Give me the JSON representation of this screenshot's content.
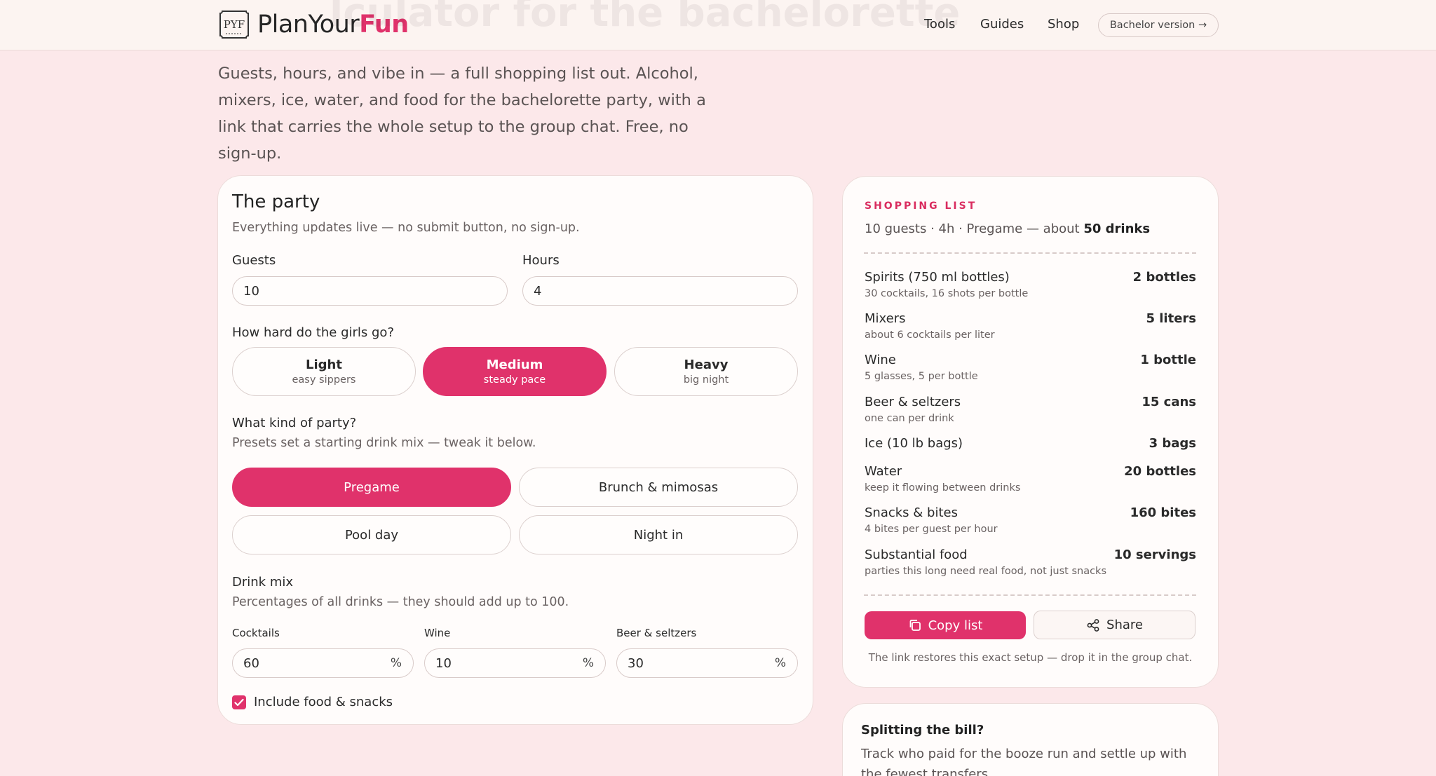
{
  "header": {
    "logo_mark_text": "PYF",
    "logo_plan": "PlanYour",
    "logo_fun": "Fun",
    "nav": [
      {
        "label": "Tools"
      },
      {
        "label": "Guides"
      },
      {
        "label": "Shop"
      }
    ],
    "bachelor_button": "Bachelor version →",
    "ghost_title": "lculator for the bachelorette"
  },
  "intro": "Guests, hours, and vibe in — a full shopping list out. Alcohol, mixers, ice, water, and food for the bachelorette party, with a link that carries the whole setup to the group chat. Free, no sign-up.",
  "party": {
    "title": "The party",
    "subtitle": "Everything updates live — no submit button, no sign-up.",
    "guests_label": "Guests",
    "guests_value": "10",
    "hours_label": "Hours",
    "hours_value": "4",
    "intensity_question": "How hard do the girls go?",
    "intensity": [
      {
        "label": "Light",
        "sub": "easy sippers",
        "active": false
      },
      {
        "label": "Medium",
        "sub": "steady pace",
        "active": true
      },
      {
        "label": "Heavy",
        "sub": "big night",
        "active": false
      }
    ],
    "kind_question": "What kind of party?",
    "kind_sub": "Presets set a starting drink mix — tweak it below.",
    "presets": [
      {
        "label": "Pregame",
        "active": true
      },
      {
        "label": "Brunch & mimosas",
        "active": false
      },
      {
        "label": "Pool day",
        "active": false
      },
      {
        "label": "Night in",
        "active": false
      }
    ],
    "mix_title": "Drink mix",
    "mix_sub": "Percentages of all drinks — they should add up to 100.",
    "mix": [
      {
        "label": "Cocktails",
        "value": "60",
        "unit": "%"
      },
      {
        "label": "Wine",
        "value": "10",
        "unit": "%"
      },
      {
        "label": "Beer & seltzers",
        "value": "30",
        "unit": "%"
      }
    ],
    "food_checkbox_label": "Include food & snacks",
    "food_checked": true
  },
  "shopping": {
    "eyebrow": "SHOPPING LIST",
    "summary_prefix": "10 guests · 4h · Pregame — about ",
    "summary_bold": "50 drinks",
    "items": [
      {
        "name": "Spirits (750 ml bottles)",
        "desc": "30 cocktails, 16 shots per bottle",
        "value": "2 bottles"
      },
      {
        "name": "Mixers",
        "desc": "about 6 cocktails per liter",
        "value": "5 liters"
      },
      {
        "name": "Wine",
        "desc": "5 glasses, 5 per bottle",
        "value": "1 bottle"
      },
      {
        "name": "Beer & seltzers",
        "desc": "one can per drink",
        "value": "15 cans"
      },
      {
        "name": "Ice (10 lb bags)",
        "desc": "",
        "value": "3 bags"
      },
      {
        "name": "Water",
        "desc": "keep it flowing between drinks",
        "value": "20 bottles"
      },
      {
        "name": "Snacks & bites",
        "desc": "4 bites per guest per hour",
        "value": "160 bites"
      },
      {
        "name": "Substantial food",
        "desc": "parties this long need real food, not just snacks",
        "value": "10 servings"
      }
    ],
    "copy_label": "Copy list",
    "share_label": "Share",
    "footnote": "The link restores this exact setup — drop it in the group chat."
  },
  "split": {
    "title": "Splitting the bill?",
    "text": "Track who paid for the booze run and settle up with the fewest transfers."
  },
  "colors": {
    "accent": "#e0326b",
    "background": "#fce8ea",
    "card": "#fffcfb"
  }
}
